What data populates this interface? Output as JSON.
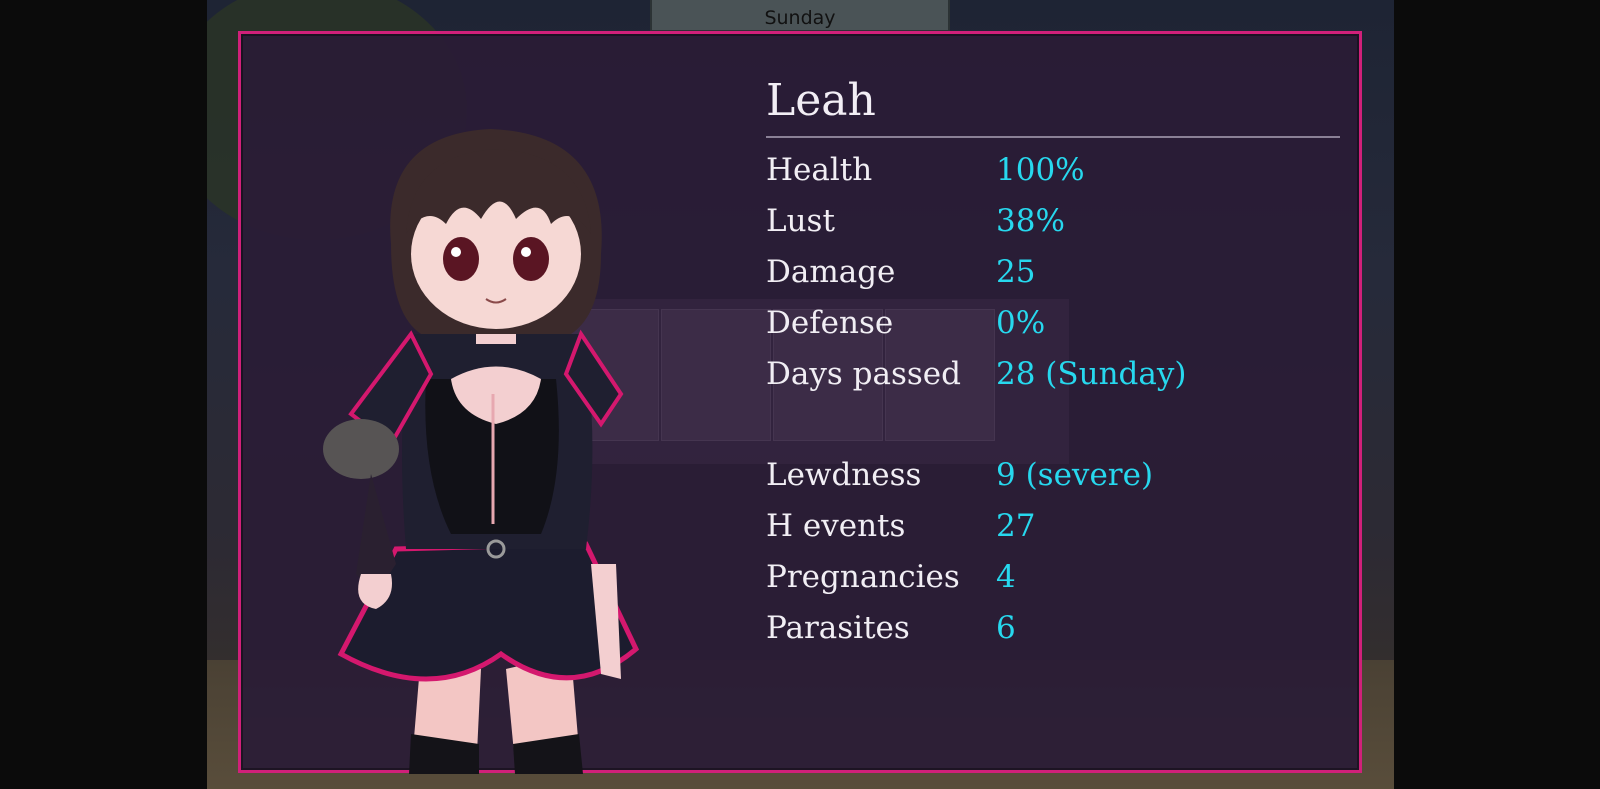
{
  "top_tab": {
    "day": "Sunday"
  },
  "character": {
    "name": "Leah",
    "stats": [
      {
        "label": "Health",
        "value": "100%"
      },
      {
        "label": "Lust",
        "value": "38%"
      },
      {
        "label": "Damage",
        "value": "25"
      },
      {
        "label": "Defense",
        "value": "0%"
      },
      {
        "label": "Days passed",
        "value": "28 (Sunday)"
      }
    ],
    "records": [
      {
        "label": "Lewdness",
        "value": "9 (severe)"
      },
      {
        "label": "H events",
        "value": "27"
      },
      {
        "label": "Pregnancies",
        "value": "4"
      },
      {
        "label": "Parasites",
        "value": "6"
      }
    ]
  },
  "colors": {
    "panel_border": "#d0207a",
    "value_text": "#27d8ee",
    "label_text": "#f1eef4"
  }
}
